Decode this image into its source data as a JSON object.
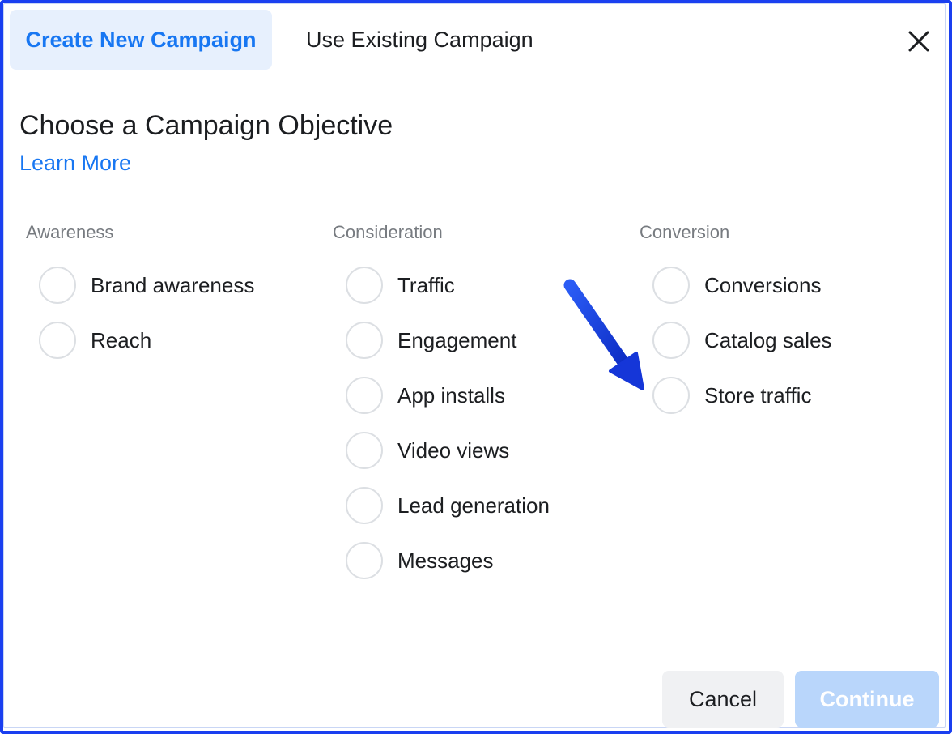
{
  "tabs": {
    "create_new": "Create New Campaign",
    "use_existing": "Use Existing Campaign"
  },
  "heading": {
    "title": "Choose a Campaign Objective",
    "learn_more": "Learn More"
  },
  "columns": [
    {
      "heading": "Awareness",
      "options": [
        "Brand awareness",
        "Reach"
      ]
    },
    {
      "heading": "Consideration",
      "options": [
        "Traffic",
        "Engagement",
        "App installs",
        "Video views",
        "Lead generation",
        "Messages"
      ]
    },
    {
      "heading": "Conversion",
      "options": [
        "Conversions",
        "Catalog sales",
        "Store traffic"
      ]
    }
  ],
  "footer": {
    "cancel": "Cancel",
    "continue": "Continue"
  },
  "colors": {
    "accent": "#1877f2",
    "frame": "#1a3ff0",
    "annotation_arrow": "#1536d8"
  },
  "annotation": {
    "icon": "arrow-icon",
    "points_to": "Store traffic"
  }
}
